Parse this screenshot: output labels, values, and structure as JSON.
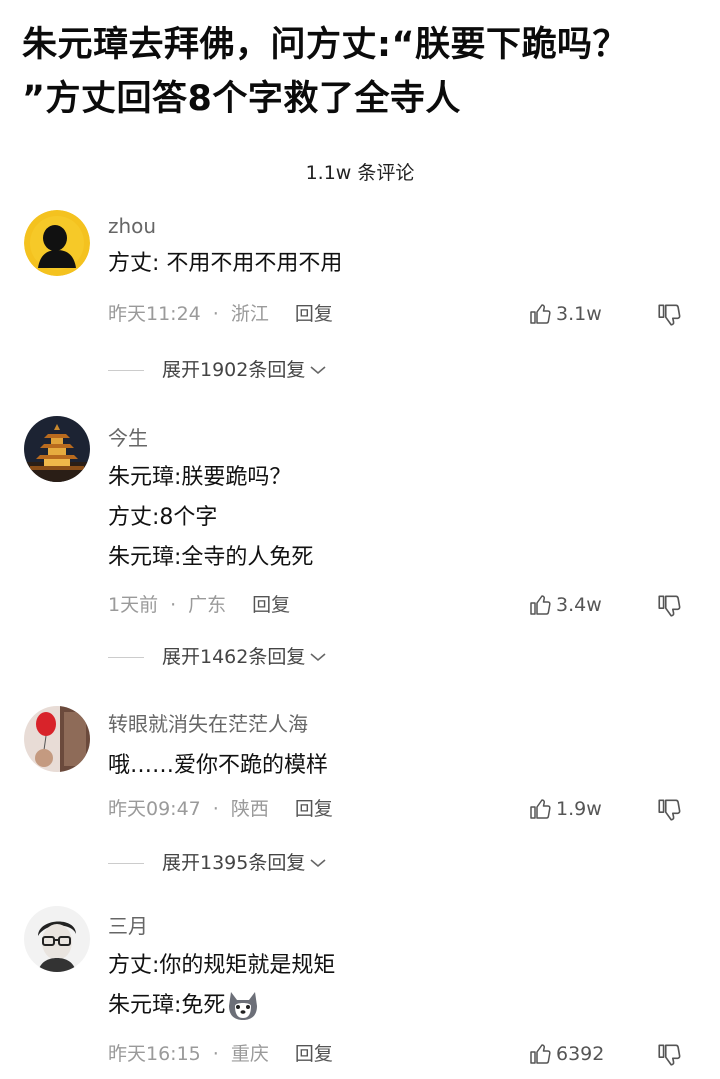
{
  "article": {
    "title_line1": "朱元璋去拜佛，问方丈:“朕要下跪吗？",
    "title_line2": "”方丈回答8个字救了全寺人"
  },
  "comment_count": "1.1w 条评论",
  "comments": [
    {
      "user": "zhou",
      "avatar": "silhouette-avatar",
      "lines": [
        "方丈: 不用不用不用不用"
      ],
      "time": "昨天11:24",
      "location": "浙江",
      "reply": "回复",
      "likes": "3.1w",
      "expand": "展开1902条回复"
    },
    {
      "user": "今生",
      "avatar": "pagoda-avatar",
      "lines": [
        "朱元璋:朕要跪吗？",
        "方丈:8个字",
        "朱元璋:全寺的人免死"
      ],
      "time": "1天前",
      "location": "广东",
      "reply": "回复",
      "likes": "3.4w",
      "expand": "展开1462条回复"
    },
    {
      "user": "转眼就消失在茫茫人海",
      "avatar": "balloon-avatar",
      "lines": [
        "哦……爱你不跪的模样"
      ],
      "time": "昨天09:47",
      "location": "陕西",
      "reply": "回复",
      "likes": "1.9w",
      "expand": "展开1395条回复"
    },
    {
      "user": "三月",
      "avatar": "glasses-man-avatar",
      "lines": [
        "方丈:你的规矩就是规矩",
        "朱元璋:免死"
      ],
      "emoji": "husky-emoji",
      "time": "昨天16:15",
      "location": "重庆",
      "reply": "回复",
      "likes": "6392"
    }
  ],
  "icons": {
    "like": "thumbs-up-icon",
    "dislike": "thumbs-down-icon",
    "expand": "chevron-down-icon"
  },
  "colors": {
    "text": "#111111",
    "meta": "#9a9a9a",
    "avatar_yellow": "#f4c21f"
  }
}
